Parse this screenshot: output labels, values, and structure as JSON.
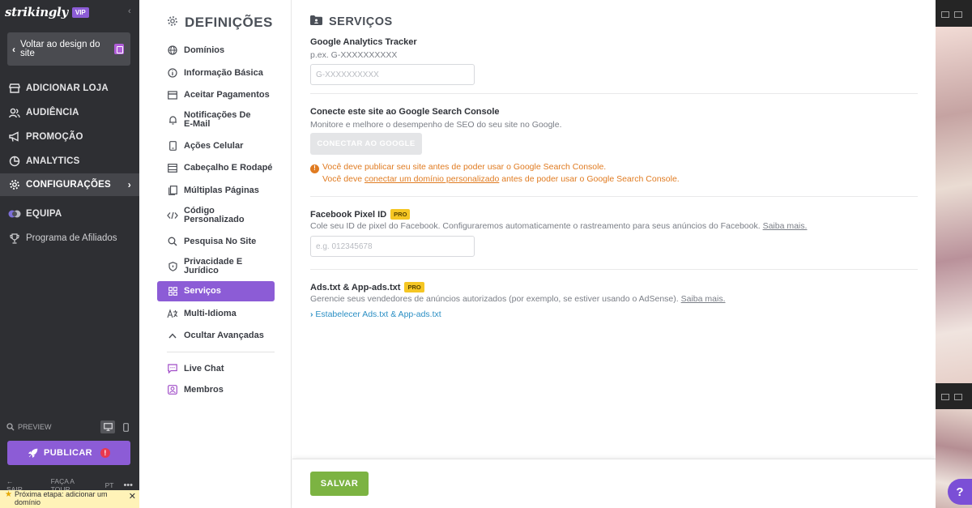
{
  "sidebar": {
    "logo": "strikingly",
    "badge": "VIP",
    "back_label": "Voltar ao design do site",
    "nav": [
      {
        "label": "ADICIONAR LOJA",
        "icon": "store-icon"
      },
      {
        "label": "AUDIÊNCIA",
        "icon": "audience-icon"
      },
      {
        "label": "PROMOÇÃO",
        "icon": "megaphone-icon"
      },
      {
        "label": "ANALYTICS",
        "icon": "analytics-icon"
      },
      {
        "label": "CONFIGURAÇÕES",
        "icon": "gear-icon"
      },
      {
        "label": "EQUIPA",
        "icon": "team-icon"
      },
      {
        "label": "Programa de Afiliados",
        "icon": "trophy-icon"
      }
    ],
    "preview_label": "PREVIEW",
    "publish_label": "PUBLICAR",
    "footer": {
      "exit": "SAIR",
      "tour": "FAÇA A TOUR",
      "lang": "PT"
    },
    "next_step": "Próxima etapa: adicionar um domínio"
  },
  "settings": {
    "title": "DEFINIÇÕES",
    "items": [
      {
        "label": "Domínios",
        "icon": "globe-icon"
      },
      {
        "label": "Informação Básica",
        "icon": "info-icon"
      },
      {
        "label": "Aceitar Pagamentos",
        "icon": "payment-icon"
      },
      {
        "label": "Notificações De E-Mail",
        "icon": "bell-icon"
      },
      {
        "label": "Ações Celular",
        "icon": "mobile-icon"
      },
      {
        "label": "Cabeçalho E Rodapé",
        "icon": "layout-icon"
      },
      {
        "label": "Múltiplas Páginas",
        "icon": "pages-icon"
      },
      {
        "label": "Código Personalizado",
        "icon": "code-icon"
      },
      {
        "label": "Pesquisa No Site",
        "icon": "search-icon"
      },
      {
        "label": "Privacidade E Jurídico",
        "icon": "shield-icon"
      },
      {
        "label": "Serviços",
        "icon": "grid-icon"
      },
      {
        "label": "Multi-Idioma",
        "icon": "language-icon"
      },
      {
        "label": "Ocultar Avançadas",
        "icon": "chevron-up-icon"
      },
      {
        "label": "Live Chat",
        "icon": "chat-icon"
      },
      {
        "label": "Membros",
        "icon": "members-icon"
      }
    ]
  },
  "main": {
    "title": "SERVIÇOS",
    "ga": {
      "label": "Google Analytics Tracker",
      "example": "p.ex. G-XXXXXXXXXX",
      "placeholder": "G-XXXXXXXXXX"
    },
    "gsc": {
      "label": "Conecte este site ao Google Search Console",
      "desc": "Monitore e melhore o desempenho de SEO do seu site no Google.",
      "button": "CONECTAR AO GOOGLE",
      "warn1": "Você deve publicar seu site antes de poder usar o Google Search Console.",
      "warn2_pre": "Você deve ",
      "warn2_link": "conectar um domínio personalizado",
      "warn2_post": " antes de poder usar o Google Search Console."
    },
    "fb": {
      "label": "Facebook Pixel ID",
      "badge": "PRO",
      "desc": "Cole seu ID de pixel do Facebook. Configuraremos automaticamente o rastreamento para seus anúncios do Facebook.",
      "link": "Saiba mais.",
      "placeholder": "e.g. 012345678"
    },
    "ads": {
      "label": "Ads.txt & App-ads.txt",
      "badge": "PRO",
      "desc": "Gerencie seus vendedores de anúncios autorizados (por exemplo, se estiver usando o AdSense).",
      "link": "Saiba mais.",
      "expand": "Estabelecer Ads.txt & App-ads.txt"
    },
    "save": "SALVAR"
  },
  "help_label": "?",
  "colors": {
    "accent": "#8c5cd6",
    "save": "#7cb342",
    "warning": "#e07b21",
    "link": "#2b8fc4"
  }
}
